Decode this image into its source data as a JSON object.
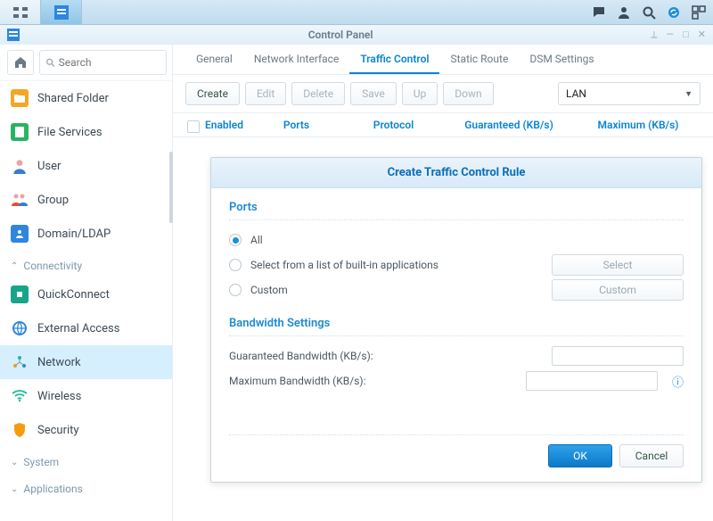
{
  "taskbar": {
    "right_icons": [
      "chat-icon",
      "person-icon",
      "search-icon",
      "sync-icon",
      "widgets-icon"
    ]
  },
  "window": {
    "title": "Control Panel",
    "buttons": [
      "pin",
      "minimize",
      "maximize",
      "close"
    ]
  },
  "search": {
    "placeholder": "Search"
  },
  "sidebar": {
    "items": [
      {
        "label": "Shared Folder",
        "ico": "folder",
        "fg": "#fff",
        "bg": "#f5a623"
      },
      {
        "label": "File Services",
        "ico": "files",
        "fg": "#fff",
        "bg": "#28b463"
      },
      {
        "label": "User",
        "ico": "user",
        "fg": "#fff",
        "bg": "#f39c12"
      },
      {
        "label": "Group",
        "ico": "group",
        "fg": "#fff",
        "bg": "#e74c3c"
      },
      {
        "label": "Domain/LDAP",
        "ico": "ldap",
        "fg": "#fff",
        "bg": "#2e86de"
      }
    ],
    "section1": "Connectivity",
    "conn": [
      {
        "label": "QuickConnect",
        "ico": "qc",
        "fg": "#fff",
        "bg": "#17a589"
      },
      {
        "label": "External Access",
        "ico": "globe",
        "fg": "#2e86de",
        "bg": ""
      },
      {
        "label": "Network",
        "ico": "net",
        "fg": "#1abc9c",
        "bg": "",
        "active": true
      },
      {
        "label": "Wireless",
        "ico": "wifi",
        "fg": "#1abc9c",
        "bg": ""
      },
      {
        "label": "Security",
        "ico": "shield",
        "fg": "#f39c12",
        "bg": ""
      }
    ],
    "section2": "System",
    "section3": "Applications"
  },
  "tabs": [
    {
      "label": "General"
    },
    {
      "label": "Network Interface"
    },
    {
      "label": "Traffic Control",
      "active": true
    },
    {
      "label": "Static Route"
    },
    {
      "label": "DSM Settings"
    }
  ],
  "toolbar": {
    "create": "Create",
    "edit": "Edit",
    "delete": "Delete",
    "save": "Save",
    "up": "Up",
    "down": "Down",
    "interface": "LAN"
  },
  "thead": {
    "enabled": "Enabled",
    "ports": "Ports",
    "protocol": "Protocol",
    "guaranteed": "Guaranteed (KB/s)",
    "maximum": "Maximum (KB/s)"
  },
  "dialog": {
    "title": "Create Traffic Control Rule",
    "ports_section": "Ports",
    "opt_all": "All",
    "opt_builtin": "Select from a list of built-in applications",
    "btn_select": "Select",
    "opt_custom": "Custom",
    "btn_custom": "Custom",
    "bw_section": "Bandwidth Settings",
    "guaranteed_label": "Guaranteed Bandwidth (KB/s):",
    "maximum_label": "Maximum Bandwidth (KB/s):",
    "guaranteed_value": "",
    "maximum_value": "",
    "ok": "OK",
    "cancel": "Cancel"
  }
}
